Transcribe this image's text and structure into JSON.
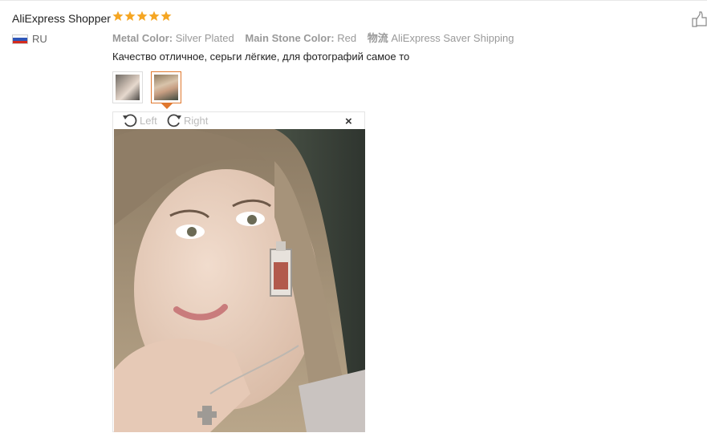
{
  "review": {
    "user_name": "AliExpress Shopper",
    "rating": 5,
    "country_code": "RU",
    "attributes": [
      {
        "key": "Metal Color:",
        "value": "Silver Plated"
      },
      {
        "key": "Main Stone Color:",
        "value": "Red"
      }
    ],
    "shipping_icon": "物流",
    "shipping": "AliExpress Saver Shipping",
    "text": "Качество отличное, серьги лёгкие, для фотографий самое то"
  },
  "viewer": {
    "rotate_left": "Left",
    "rotate_right": "Right",
    "close": "×"
  },
  "icons": {
    "star": "star-icon",
    "like": "thumbs-up-icon",
    "flag": "russia-flag-icon",
    "rotate_left": "rotate-left-icon",
    "rotate_right": "rotate-right-icon",
    "close": "close-icon"
  },
  "colors": {
    "star": "#f5a623",
    "accent": "#e0782e",
    "muted": "#999999"
  }
}
